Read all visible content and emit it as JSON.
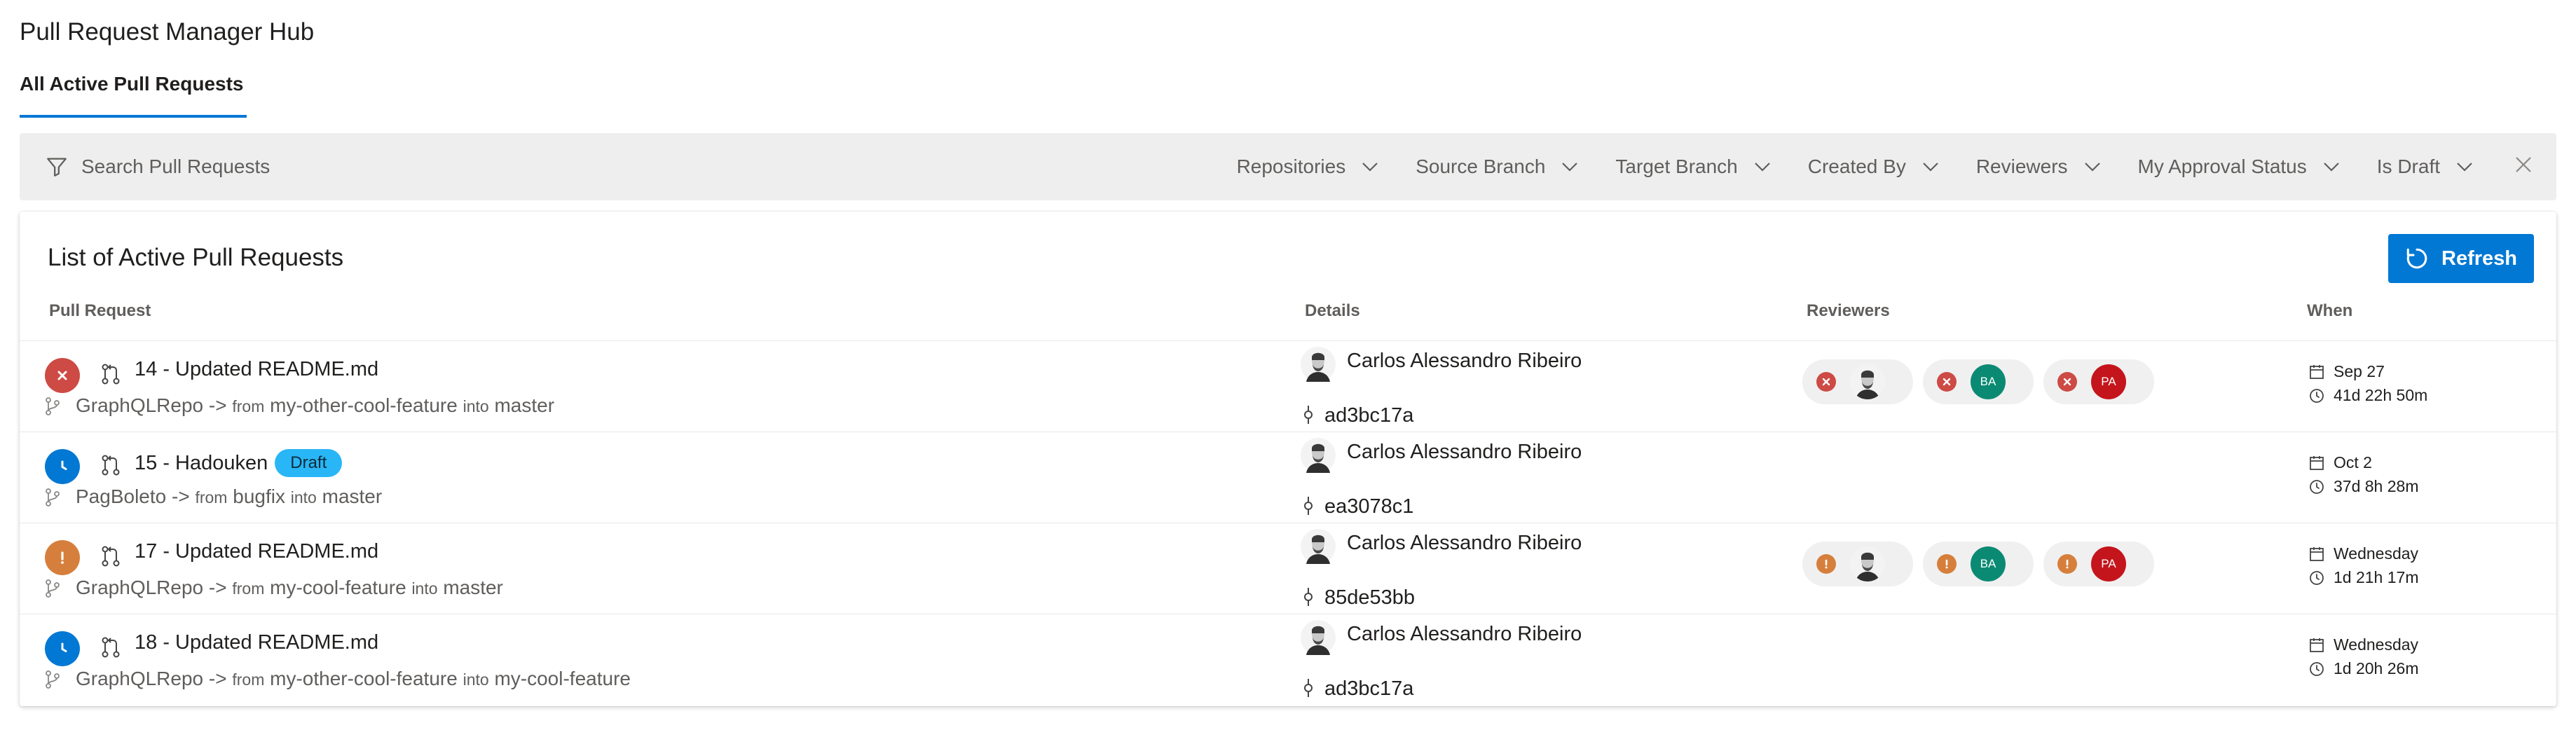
{
  "header": {
    "title": "Pull Request Manager Hub"
  },
  "tabs": [
    {
      "label": "All Active Pull Requests"
    }
  ],
  "filter_bar": {
    "search_placeholder": "Search Pull Requests",
    "filters": [
      "Repositories",
      "Source Branch",
      "Target Branch",
      "Created By",
      "Reviewers",
      "My Approval Status",
      "Is Draft"
    ]
  },
  "list": {
    "title": "List of Active Pull Requests",
    "refresh_label": "Refresh",
    "columns": {
      "pull_request": "Pull Request",
      "details": "Details",
      "reviewers": "Reviewers",
      "when": "When"
    },
    "from_word": "from",
    "into_word": "into",
    "arrow": "->",
    "rows": [
      {
        "status": "rejected",
        "title": "14 - Updated README.md",
        "draft": "",
        "repo": "GraphQLRepo",
        "source": "my-other-cool-feature",
        "target": "master",
        "author": "Carlos Alessandro Ribeiro",
        "commit": "ad3bc17a",
        "reviewers": [
          {
            "vote": "rejected",
            "avatar": "photo",
            "initials": ""
          },
          {
            "vote": "rejected",
            "avatar": "initials",
            "initials": "BA",
            "color": "#0b8a73"
          },
          {
            "vote": "rejected",
            "avatar": "initials",
            "initials": "PA",
            "color": "#c4151c"
          }
        ],
        "date": "Sep 27",
        "duration": "41d 22h 50m"
      },
      {
        "status": "waiting",
        "title": "15 - Hadouken",
        "draft": "Draft",
        "repo": "PagBoleto",
        "source": "bugfix",
        "target": "master",
        "author": "Carlos Alessandro Ribeiro",
        "commit": "ea3078c1",
        "reviewers": [],
        "date": "Oct 2",
        "duration": "37d 8h 28m"
      },
      {
        "status": "warning",
        "title": "17 - Updated README.md",
        "draft": "",
        "repo": "GraphQLRepo",
        "source": "my-cool-feature",
        "target": "master",
        "author": "Carlos Alessandro Ribeiro",
        "commit": "85de53bb",
        "reviewers": [
          {
            "vote": "warning",
            "avatar": "photo",
            "initials": ""
          },
          {
            "vote": "warning",
            "avatar": "initials",
            "initials": "BA",
            "color": "#0b8a73"
          },
          {
            "vote": "warning",
            "avatar": "initials",
            "initials": "PA",
            "color": "#c4151c"
          }
        ],
        "date": "Wednesday",
        "duration": "1d 21h 17m"
      },
      {
        "status": "waiting",
        "title": "18 - Updated README.md",
        "draft": "",
        "repo": "GraphQLRepo",
        "source": "my-other-cool-feature",
        "target": "my-cool-feature",
        "author": "Carlos Alessandro Ribeiro",
        "commit": "ad3bc17a",
        "reviewers": [],
        "date": "Wednesday",
        "duration": "1d 20h 26m"
      }
    ]
  },
  "colors": {
    "accent": "#0078d4",
    "rejected": "#cd4a45",
    "waiting": "#0078d4",
    "warning": "#d67f3c",
    "draft_badge": "#29b6f6"
  }
}
